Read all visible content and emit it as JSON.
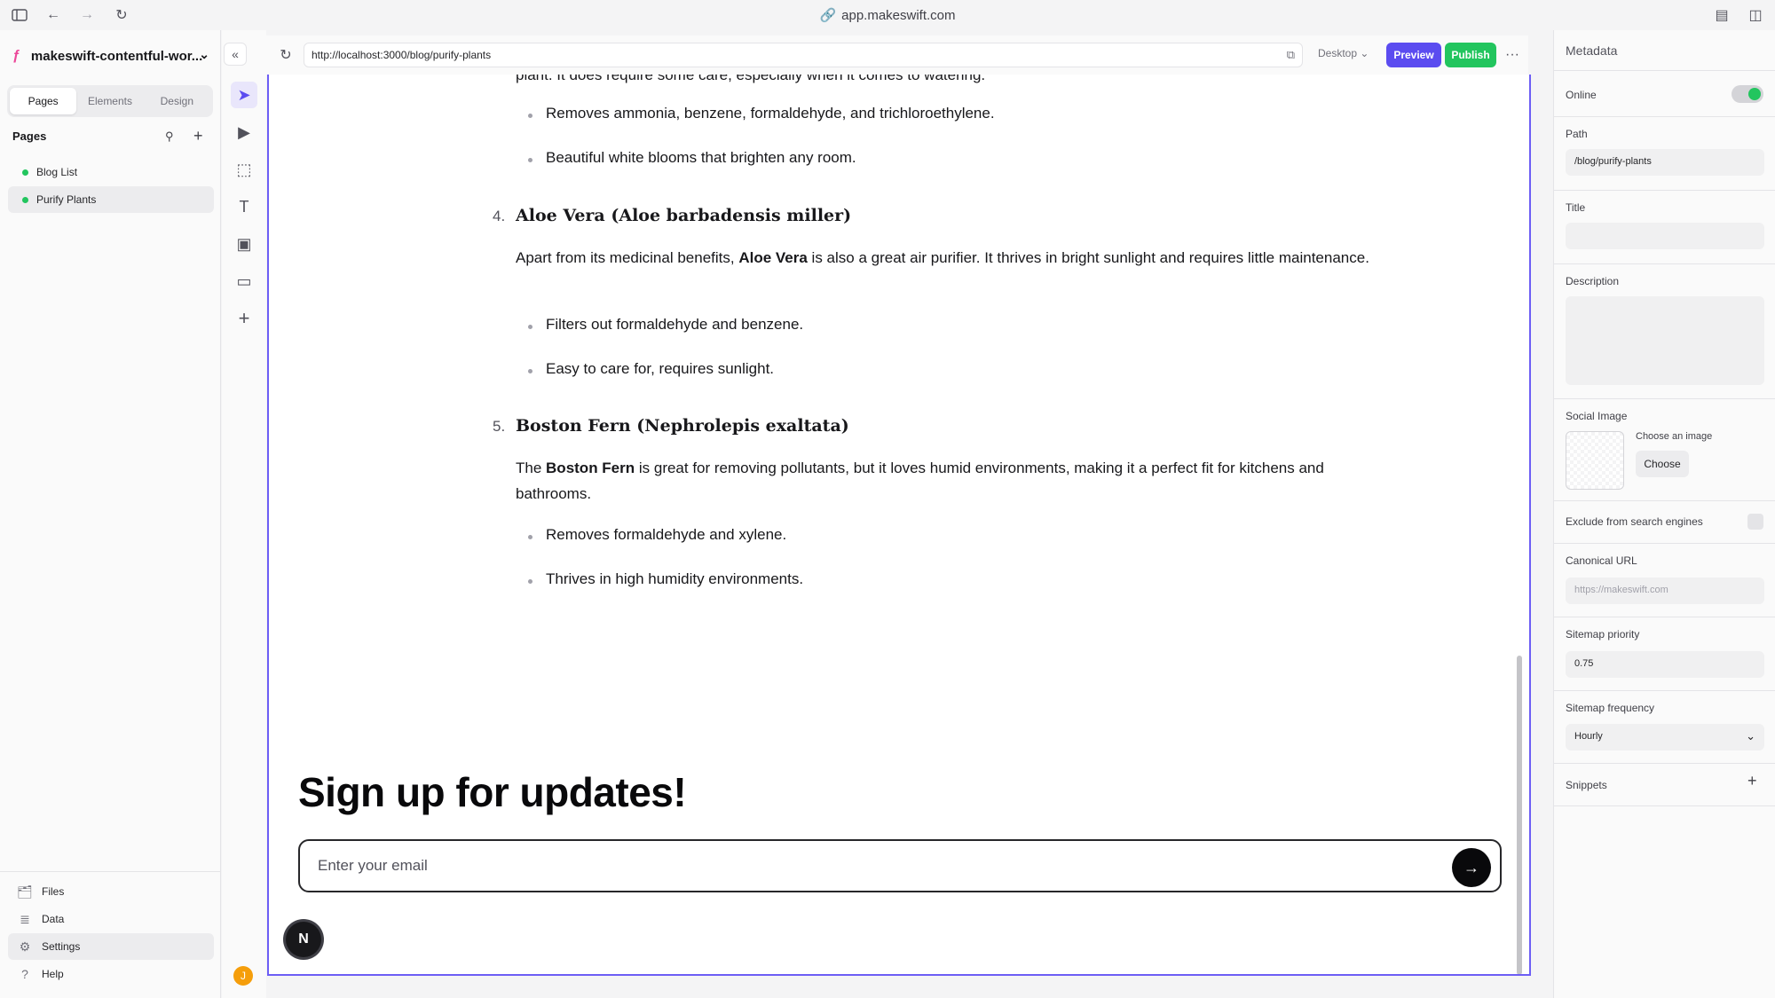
{
  "browser": {
    "address": "app.makeswift.com"
  },
  "sidebar": {
    "site_name": "makeswift-contentful-wor...",
    "tabs": [
      "Pages",
      "Elements",
      "Design"
    ],
    "pages_heading": "Pages",
    "pages": [
      "Blog List",
      "Purify Plants"
    ],
    "bottom": [
      "Files",
      "Data",
      "Settings",
      "Help"
    ],
    "avatar_initial": "J"
  },
  "canvas": {
    "url": "http://localhost:3000/blog/purify-plants",
    "device": "Desktop",
    "preview_label": "Preview",
    "publish_label": "Publish",
    "more_label": "···"
  },
  "article": {
    "intro_cut": "plant. It does require some care, especially when it comes to watering.",
    "prev_bullets": [
      "Removes ammonia, benzene, formaldehyde, and trichloroethylene.",
      "Beautiful white blooms that brighten any room."
    ],
    "items": [
      {
        "num": "4.",
        "title": "Aloe Vera (Aloe barbadensis miller)",
        "p_before": "Apart from its medicinal benefits, ",
        "p_bold": "Aloe Vera",
        "p_after": " is also a great air purifier. It thrives in bright sunlight and requires little maintenance.",
        "bullets": [
          "Filters out formaldehyde and benzene.",
          "Easy to care for, requires sunlight."
        ]
      },
      {
        "num": "5.",
        "title": "Boston Fern (Nephrolepis exaltata)",
        "p_before": "The ",
        "p_bold": "Boston Fern",
        "p_after": " is great for removing pollutants, but it loves humid environments, making it a perfect fit for kitchens and bathrooms.",
        "bullets": [
          "Removes formaldehyde and xylene.",
          "Thrives in high humidity environments."
        ]
      }
    ]
  },
  "signup": {
    "title": "Sign up for updates!",
    "email_placeholder": "Enter your email",
    "badge": "N"
  },
  "metadata": {
    "panel_title": "Metadata",
    "online_label": "Online",
    "online": true,
    "path_label": "Path",
    "path_value": "/blog/purify-plants",
    "title_label": "Title",
    "title_value": "",
    "description_label": "Description",
    "social_image_label": "Social Image",
    "choose_image_label": "Choose an image",
    "choose_button": "Choose",
    "exclude_label": "Exclude from search engines",
    "canonical_label": "Canonical URL",
    "canonical_placeholder": "https://makeswift.com",
    "sitemap_priority_label": "Sitemap priority",
    "sitemap_priority_value": "0.75",
    "sitemap_frequency_label": "Sitemap frequency",
    "sitemap_frequency_value": "Hourly",
    "snippets_label": "Snippets"
  },
  "colors": {
    "accent": "#5b4cf0",
    "publish": "#22c55e",
    "online": "#22c55e"
  }
}
